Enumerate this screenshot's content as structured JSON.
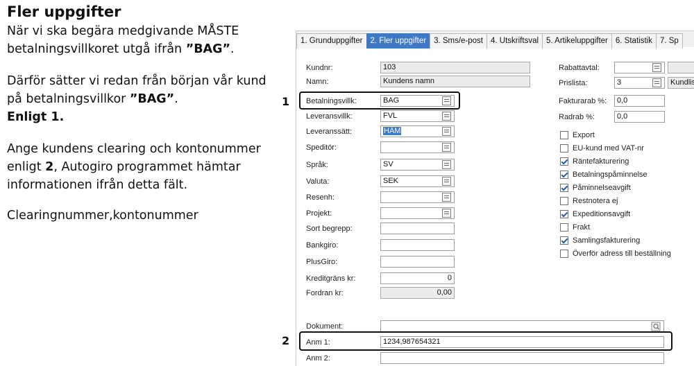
{
  "doc": {
    "title": "Fler uppgifter",
    "p1_pre": "När vi ska begära medgivande MÅSTE betalningsvillkoret utgå ifrån ",
    "p1_bold": "”BAG”",
    "p1_post": ".",
    "p2_pre": "Därför sätter vi redan från början vår kund på betalningsvillkor ",
    "p2_bold": "”BAG”",
    "p2_post": ".",
    "p2_strong": "Enligt 1.",
    "p3_pre": "Ange kundens clearing och kontonummer enligt ",
    "p3_bold": "2",
    "p3_post": ", Autogiro programmet hämtar informationen ifrån detta fält.",
    "p4": "Clearingnummer,kontonummer"
  },
  "callouts": {
    "one": "1",
    "two": "2"
  },
  "tabs": [
    "1. Grunduppgifter",
    "2. Fler uppgifter",
    "3. Sms/e-post",
    "4. Utskriftsval",
    "5. Artikeluppgifter",
    "6. Statistik",
    "7. Sp"
  ],
  "active_tab_index": 1,
  "left_fields": {
    "kundnr": {
      "label": "Kundnr:",
      "value": "103"
    },
    "namn": {
      "label": "Namn:",
      "value": "Kundens namn"
    },
    "betalningsvillk": {
      "label": "Betalningsvillk:",
      "value": "BAG"
    },
    "leveransvillk": {
      "label": "Leveransvillk:",
      "value": "FVL"
    },
    "leveranssatt": {
      "label": "Leveranssätt:",
      "value": "HÄM"
    },
    "speditor": {
      "label": "Speditör:",
      "value": ""
    },
    "sprak": {
      "label": "Språk:",
      "value": "SV"
    },
    "valuta": {
      "label": "Valuta:",
      "value": "SEK"
    },
    "resenh": {
      "label": "Resenh:",
      "value": ""
    },
    "projekt": {
      "label": "Projekt:",
      "value": ""
    },
    "sort_begrepp": {
      "label": "Sort begrepp:",
      "value": ""
    },
    "bankgiro": {
      "label": "Bankgiro:",
      "value": ""
    },
    "plusgiro": {
      "label": "PlusGiro:",
      "value": ""
    },
    "kreditgrans": {
      "label": "Kreditgräns kr:",
      "value": "0"
    },
    "fordran": {
      "label": "Fordran kr:",
      "value": "0,00"
    }
  },
  "right_fields": {
    "rabattavtal": {
      "label": "Rabattavtal:",
      "value": ""
    },
    "prislista": {
      "label": "Prislista:",
      "value": "3",
      "extra": "Kundlist"
    },
    "fakturarab": {
      "label": "Fakturarab %:",
      "value": "0,0"
    },
    "radrab": {
      "label": "Radrab %:",
      "value": "0,0"
    }
  },
  "checkboxes": [
    {
      "label": "Export",
      "checked": false
    },
    {
      "label": "EU-kund med VAT-nr",
      "checked": false
    },
    {
      "label": "Räntefakturering",
      "checked": true
    },
    {
      "label": "Betalningspåminnelse",
      "checked": true
    },
    {
      "label": "Påminnelseavgift",
      "checked": true
    },
    {
      "label": "Restnotera ej",
      "checked": false
    },
    {
      "label": "Expeditionsavgift",
      "checked": true
    },
    {
      "label": "Frakt",
      "checked": false
    },
    {
      "label": "Samlingsfakturering",
      "checked": true
    },
    {
      "label": "Överför adress till beställning",
      "checked": false
    }
  ],
  "bottom_fields": {
    "dokument": {
      "label": "Dokument:",
      "value": ""
    },
    "anm1": {
      "label": "Anm 1:",
      "value": "1234,987654321"
    },
    "anm2": {
      "label": "Anm 2:",
      "value": ""
    }
  },
  "colors": {
    "active_tab": "#3f79c4",
    "callout": "#111111"
  }
}
